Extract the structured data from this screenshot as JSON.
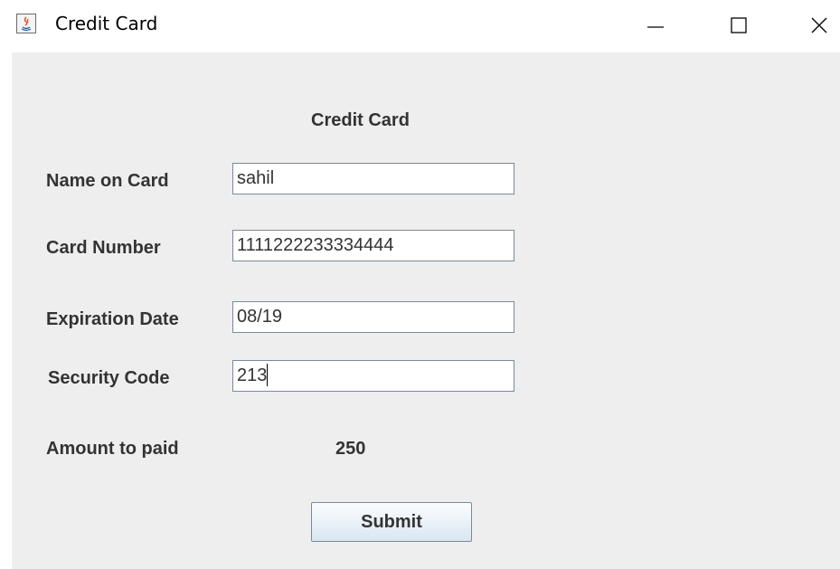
{
  "window": {
    "title": "Credit Card",
    "controls": {
      "minimize": "minimize-icon",
      "maximize": "maximize-icon",
      "close": "close-icon"
    }
  },
  "form": {
    "heading": "Credit Card",
    "fields": {
      "name": {
        "label": "Name on Card",
        "value": "sahil"
      },
      "card_number": {
        "label": "Card Number",
        "value": "1111222233334444"
      },
      "expiration": {
        "label": "Expiration Date",
        "value": "08/19"
      },
      "security_code": {
        "label": "Security Code",
        "value": "213"
      }
    },
    "amount": {
      "label": "Amount to paid",
      "value": "250"
    },
    "submit_label": "Submit"
  }
}
